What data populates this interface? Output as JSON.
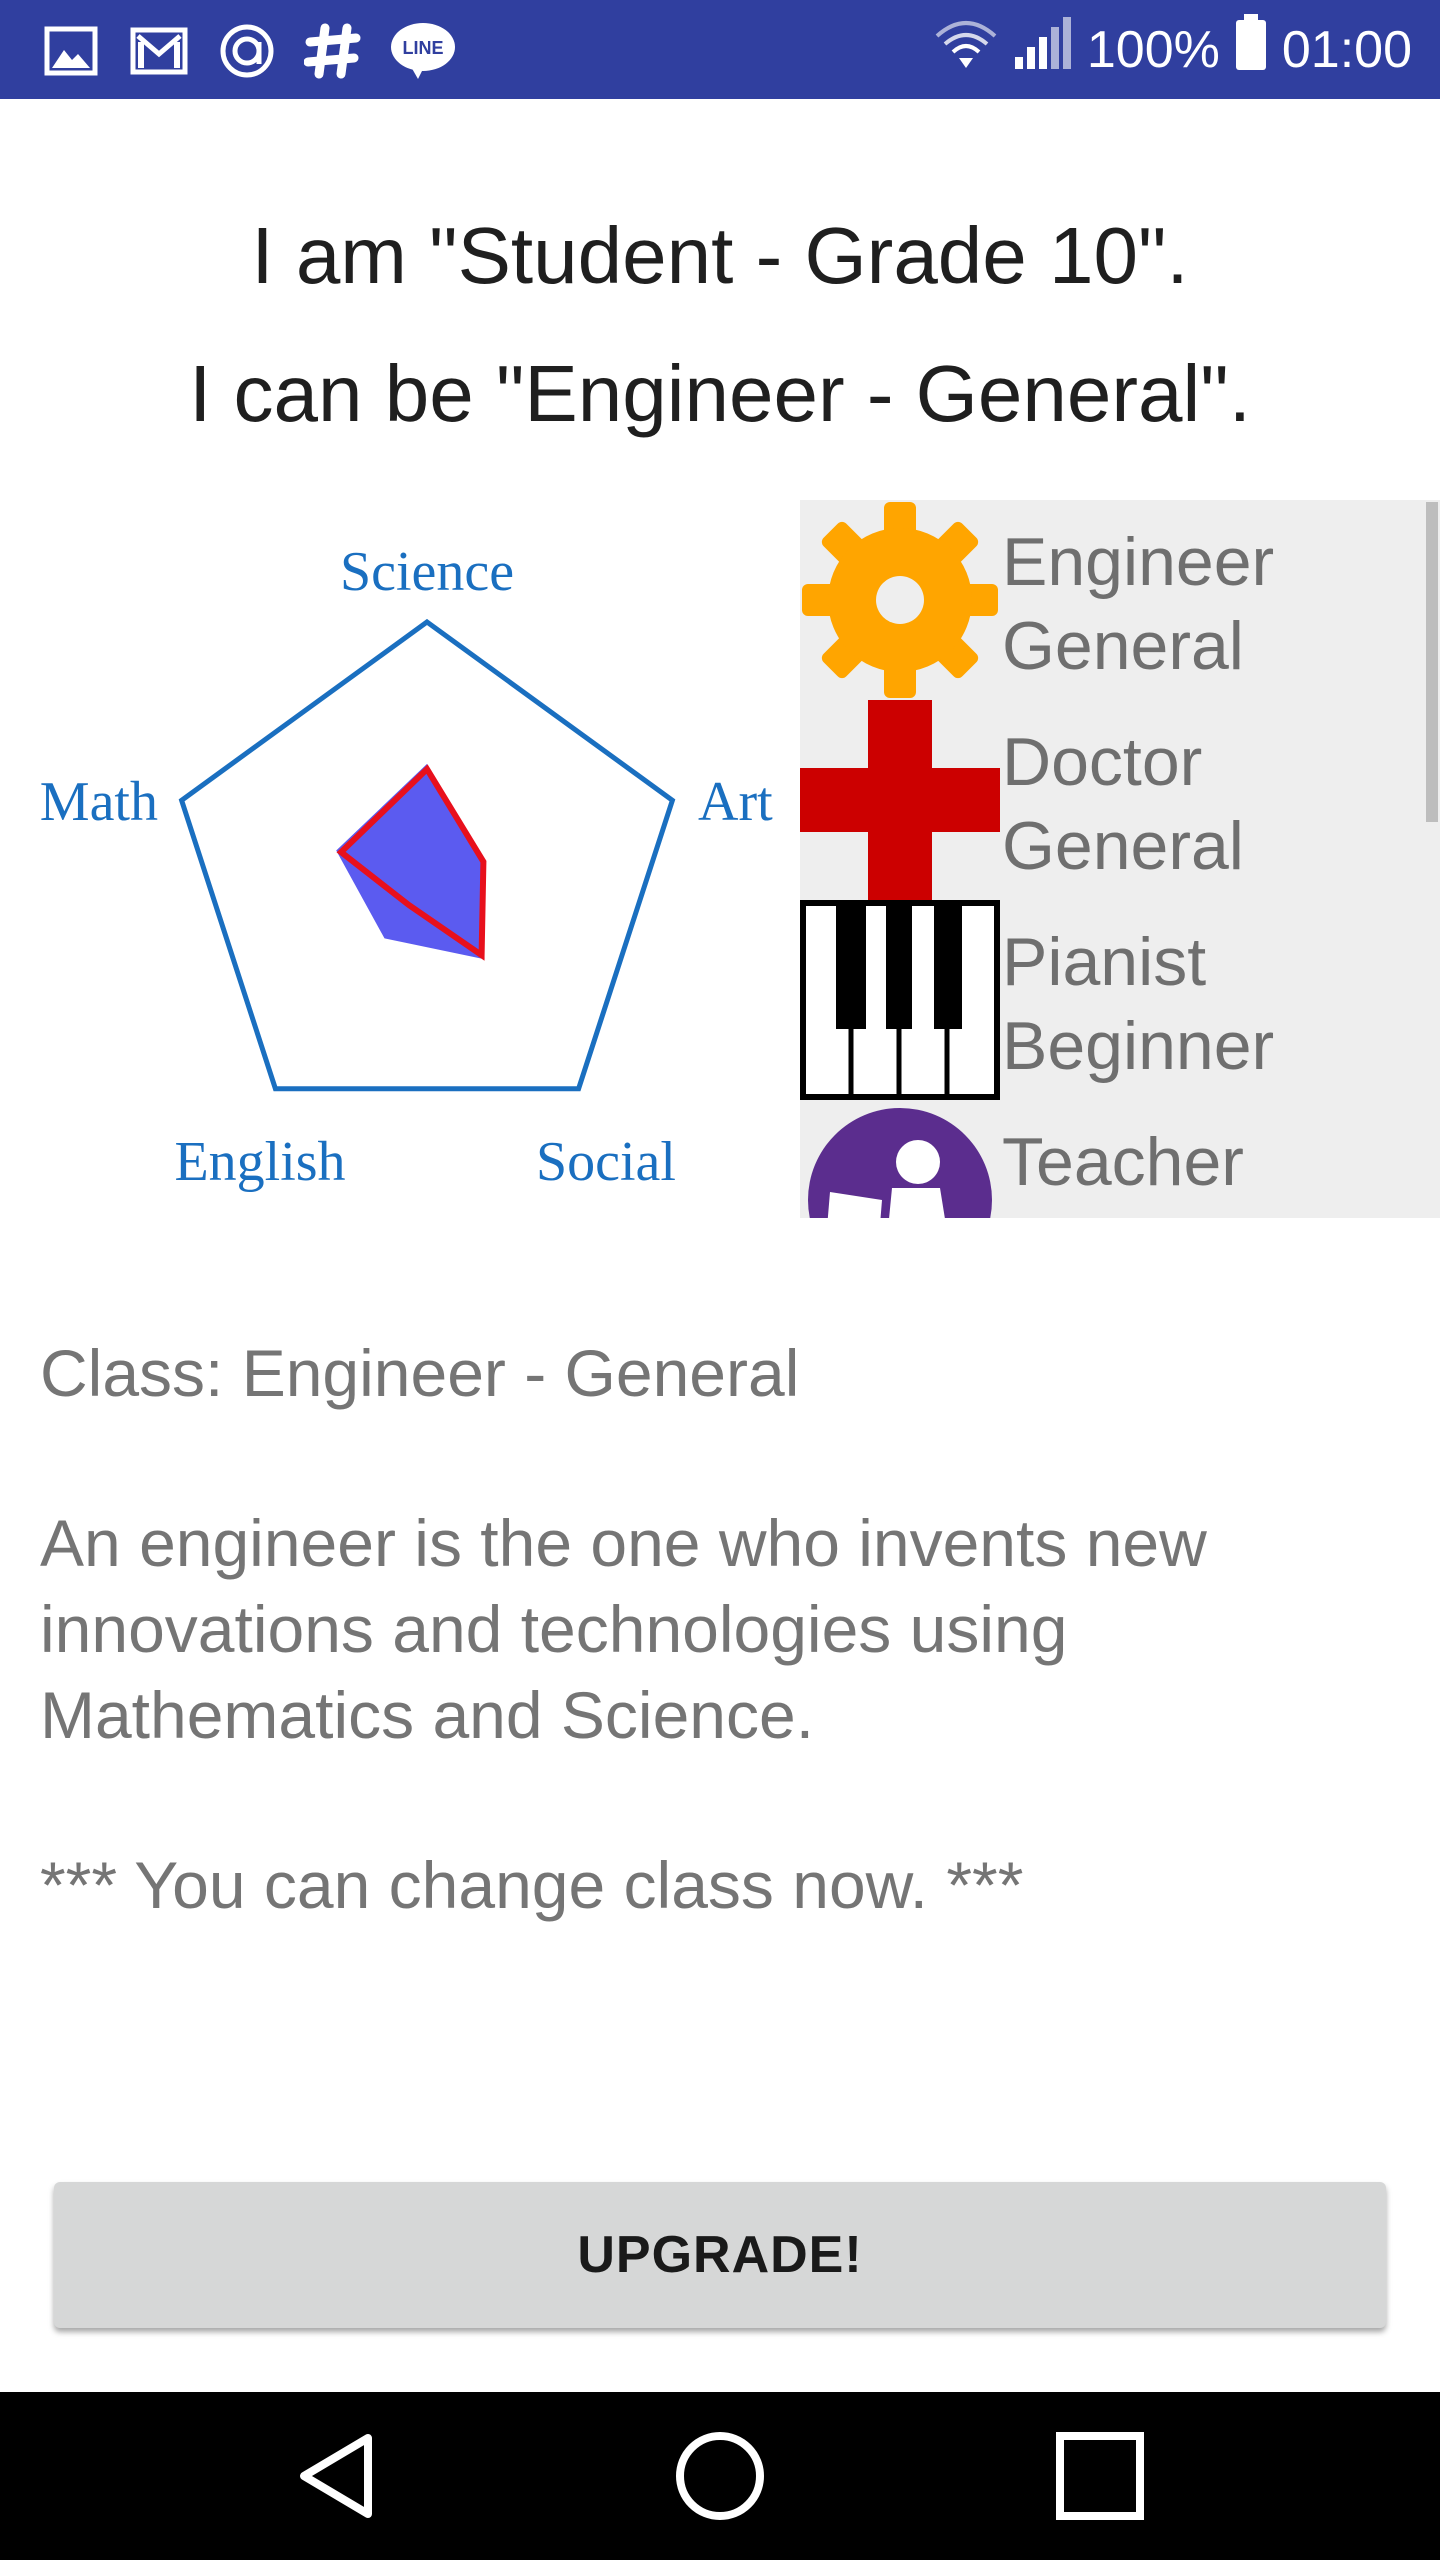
{
  "status_bar": {
    "battery": "100%",
    "time": "01:00",
    "left_icons": [
      "gallery-icon",
      "gmail-icon",
      "at-sign-icon",
      "slack-icon",
      "line-icon"
    ],
    "line_icon_text": "LINE"
  },
  "header": {
    "line1": "I am \"Student - Grade 10\".",
    "line2": "I can be \"Engineer - General\"."
  },
  "radar_chart": {
    "axes": [
      "Science",
      "Art",
      "Social",
      "English",
      "Math"
    ],
    "colors": {
      "outline": "#1a6fc0",
      "fill": "#5b5bf0",
      "highlight": "#e8101c",
      "labels": "#1a6fc0"
    }
  },
  "chart_data": {
    "type": "radar",
    "axes": [
      "Science",
      "Art",
      "Social",
      "English",
      "Math"
    ],
    "range": [
      0,
      1
    ],
    "series": [
      {
        "values": [
          0.45,
          0.22,
          0.38,
          0.28,
          0.37
        ],
        "color": "#5b5bf0"
      },
      {
        "values": [
          0.43,
          0.23,
          0.36,
          0.12,
          0.35
        ],
        "color": "#e8101c"
      }
    ]
  },
  "class_list": {
    "items": [
      {
        "line1": "Engineer",
        "line2": "General",
        "icon": "gear-icon",
        "color": "#ffa500"
      },
      {
        "line1": "Doctor",
        "line2": "General",
        "icon": "medical-cross-icon",
        "color": "#cc0000"
      },
      {
        "line1": "Pianist",
        "line2": "Beginner",
        "icon": "piano-keys-icon",
        "color": "#000000"
      },
      {
        "line1": "Teacher",
        "line2": "",
        "icon": "teacher-icon",
        "color": "#5b2d8e"
      }
    ]
  },
  "details": {
    "class_line": "Class: Engineer - General",
    "description": "An engineer is the one who invents new innovations and technologies using Mathematics and Science.",
    "notice": "*** You can change class now. ***"
  },
  "actions": {
    "upgrade_label": "UPGRADE!"
  },
  "nav_bar": {
    "buttons": [
      "back-icon",
      "home-icon",
      "recents-icon"
    ]
  }
}
